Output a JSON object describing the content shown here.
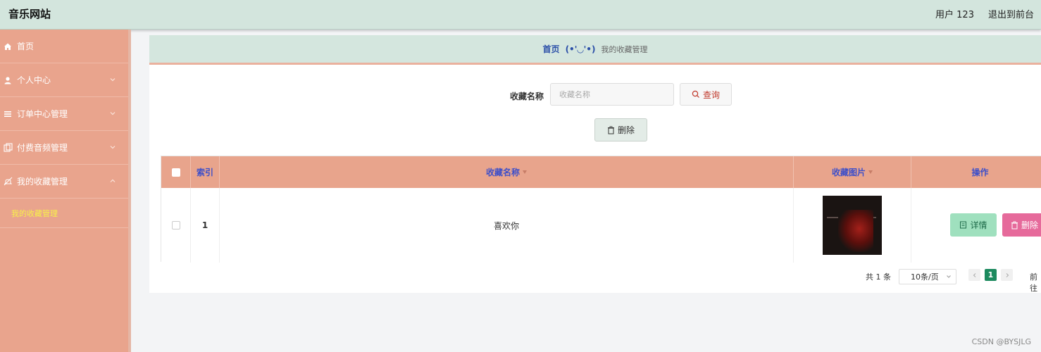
{
  "header": {
    "site_title": "音乐网站",
    "user_label": "用户 123",
    "exit_label": "退出到前台"
  },
  "sidebar": {
    "items": [
      {
        "label": "首页",
        "icon": "home-icon"
      },
      {
        "label": "个人中心",
        "icon": "user-icon"
      },
      {
        "label": "订单中心管理",
        "icon": "list-icon"
      },
      {
        "label": "付费音频管理",
        "icon": "copy-icon"
      },
      {
        "label": "我的收藏管理",
        "icon": "bell-off-icon"
      }
    ],
    "active_sub": "我的收藏管理"
  },
  "breadcrumb": {
    "home": "首页",
    "separator": "(•'◡'•)",
    "current": "我的收藏管理"
  },
  "search": {
    "label": "收藏名称",
    "placeholder": "收藏名称",
    "query_label": "查询"
  },
  "toolbar": {
    "delete_label": "删除"
  },
  "table": {
    "columns": [
      "索引",
      "收藏名称",
      "收藏图片",
      "操作"
    ],
    "rows": [
      {
        "index": "1",
        "name": "喜欢你",
        "detail_label": "详情",
        "delete_label": "删除"
      }
    ]
  },
  "pagination": {
    "total": "共 1 条",
    "page_size": "10条/页",
    "current_page": "1",
    "goto_label": "前往"
  },
  "watermark": "CSDN @BYSJLG",
  "colors": {
    "sidebar": "#e9a48d",
    "header": "#d3e5dd",
    "table_header": "#e8a48c",
    "accent_green": "#1c8a5e",
    "detail_button": "#9fe0be",
    "delete_button": "#e66a9b"
  }
}
